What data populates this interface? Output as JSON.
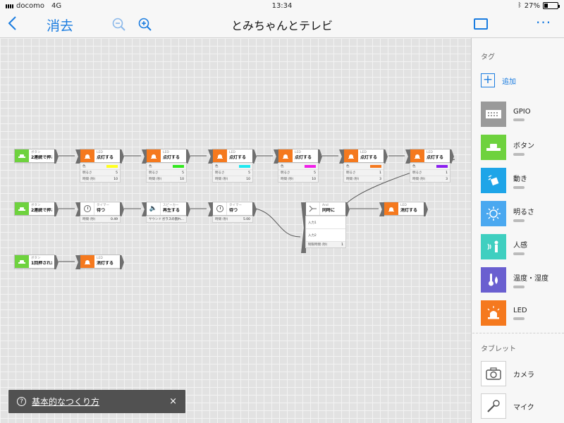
{
  "status": {
    "carrier": "docomo",
    "network": "4G",
    "time": "13:34",
    "battery": "27%",
    "battery_level": 0.27
  },
  "nav": {
    "undo_label": "消去",
    "title": "とみちゃんとテレビ"
  },
  "accent": "#1a7ce0",
  "blocks": {
    "row1": {
      "button": {
        "kind": "ボタン",
        "action": "2連続で押さ..."
      },
      "leds": [
        {
          "kind": "LED",
          "action": "点灯する",
          "color_label": "色",
          "color": "#ffff1e",
          "brightness_label": "明るさ",
          "brightness": "5",
          "time_label": "時間 (秒)",
          "time": "10"
        },
        {
          "kind": "LED",
          "action": "点灯する",
          "color_label": "色",
          "color": "#32e81e",
          "brightness_label": "明るさ",
          "brightness": "5",
          "time_label": "時間 (秒)",
          "time": "10"
        },
        {
          "kind": "LED",
          "action": "点灯する",
          "color_label": "色",
          "color": "#1ee8f0",
          "brightness_label": "明るさ",
          "brightness": "5",
          "time_label": "時間 (秒)",
          "time": "10"
        },
        {
          "kind": "LED",
          "action": "点灯する",
          "color_label": "色",
          "color": "#f01ee8",
          "brightness_label": "明るさ",
          "brightness": "5",
          "time_label": "時間 (秒)",
          "time": "10"
        },
        {
          "kind": "LED",
          "action": "点灯する",
          "color_label": "色",
          "color": "#f5791e",
          "brightness_label": "明るさ",
          "brightness": "1",
          "time_label": "時間 (秒)",
          "time": "3"
        },
        {
          "kind": "LED",
          "action": "点灯する",
          "color_label": "色",
          "color": "#8a1ef0",
          "brightness_label": "明るさ",
          "brightness": "1",
          "time_label": "時間 (秒)",
          "time": "3"
        }
      ]
    },
    "row2": {
      "button": {
        "kind": "ボタン",
        "action": "2連続で押さ..."
      },
      "timer1": {
        "kind": "タイマー",
        "action": "待つ",
        "time_label": "時間 (秒)",
        "time": "0.49"
      },
      "speaker": {
        "kind": "スピーカー",
        "action": "再生する",
        "sound_label": "サウンド",
        "sound": "ガラスの割れ..."
      },
      "timer2": {
        "kind": "タイマー",
        "action": "待つ",
        "time_label": "時間 (秒)",
        "time": "5.00"
      },
      "and": {
        "kind": "And",
        "action": "同時に",
        "input1": "入力1",
        "input2": "入力2",
        "limit_label": "制限時間 (秒)",
        "limit": "1"
      },
      "led": {
        "kind": "LED",
        "action": "消灯する"
      }
    },
    "row3": {
      "button": {
        "kind": "ボタン",
        "action": "1回押されたら"
      },
      "led": {
        "kind": "LED",
        "action": "消灯する"
      }
    }
  },
  "helper": {
    "icon": "?",
    "text": "基本的なつくり方",
    "close": "×"
  },
  "panel": {
    "tags_heading": "タグ",
    "add_label": "追加",
    "tags": [
      {
        "name": "GPIO",
        "color": "#9a9a9a",
        "icon": "gpio-icon"
      },
      {
        "name": "ボタン",
        "color": "#6ed23e",
        "icon": "button-icon"
      },
      {
        "name": "動き",
        "color": "#1ea5e8",
        "icon": "motion-icon"
      },
      {
        "name": "明るさ",
        "color": "#4aa8f0",
        "icon": "light-icon"
      },
      {
        "name": "人感",
        "color": "#3fcfc0",
        "icon": "human-sensor-icon"
      },
      {
        "name": "温度・湿度",
        "color": "#6a5fd0",
        "icon": "temperature-icon"
      },
      {
        "name": "LED",
        "color": "#f5791e",
        "icon": "led-icon"
      }
    ],
    "tablet_heading": "タブレット",
    "tablet": [
      {
        "name": "カメラ",
        "icon": "camera-icon"
      },
      {
        "name": "マイク",
        "icon": "mic-icon"
      }
    ]
  }
}
